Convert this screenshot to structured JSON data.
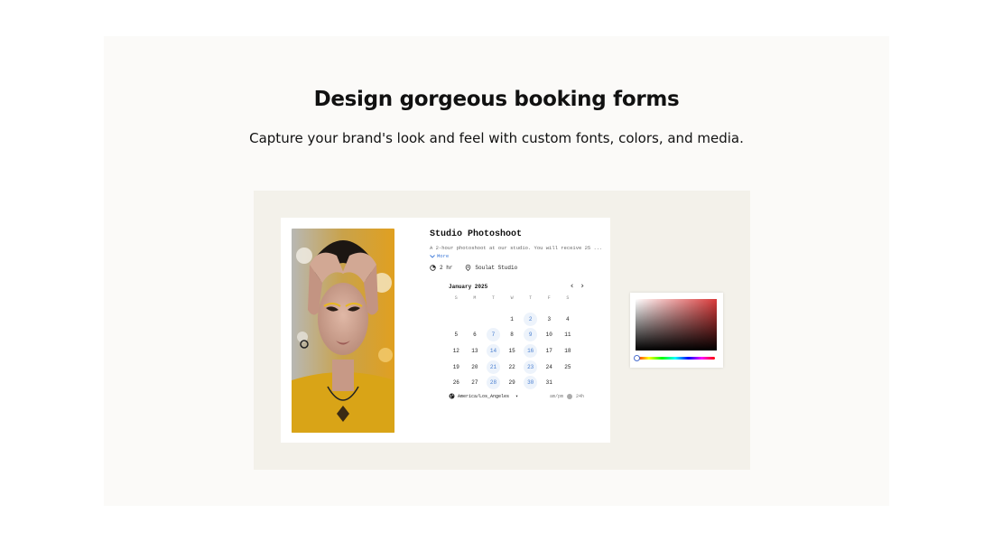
{
  "hero": {
    "title": "Design gorgeous booking forms",
    "subtitle": "Capture your brand's look and feel with custom fonts, colors, and media."
  },
  "booking": {
    "event_title": "Studio Photoshoot",
    "description": "A 2-hour photoshoot at our studio. You will receive 25 ...",
    "more_label": "More",
    "duration": "2 hr",
    "location": "Soulat Studio",
    "month_label": "January 2025",
    "weekdays": [
      "S",
      "M",
      "T",
      "W",
      "T",
      "F",
      "S"
    ],
    "timezone": "America/Los_Angeles",
    "format_ampm": "am/pm",
    "format_24h": "24h",
    "weeks": [
      [
        null,
        null,
        null,
        "1",
        "2",
        "3",
        "4"
      ],
      [
        "5",
        "6",
        "7",
        "8",
        "9",
        "10",
        "11"
      ],
      [
        "12",
        "13",
        "14",
        "15",
        "16",
        "17",
        "18"
      ],
      [
        "19",
        "20",
        "21",
        "22",
        "23",
        "24",
        "25"
      ],
      [
        "26",
        "27",
        "28",
        "29",
        "30",
        "31",
        null
      ]
    ],
    "available_days": [
      "2",
      "7",
      "9",
      "14",
      "16",
      "21",
      "23",
      "28",
      "30"
    ]
  },
  "colors": {
    "available_bg": "#edf3fb",
    "available_text": "#4a7fd0",
    "accent_red": "#d93a3a",
    "frame_bg": "#f3f1ea"
  },
  "icons": {
    "duration": "clock-icon",
    "location": "map-pin-icon",
    "timezone": "globe-icon",
    "prev": "chevron-left-icon",
    "next": "chevron-right-icon",
    "more": "chevron-down-icon"
  }
}
